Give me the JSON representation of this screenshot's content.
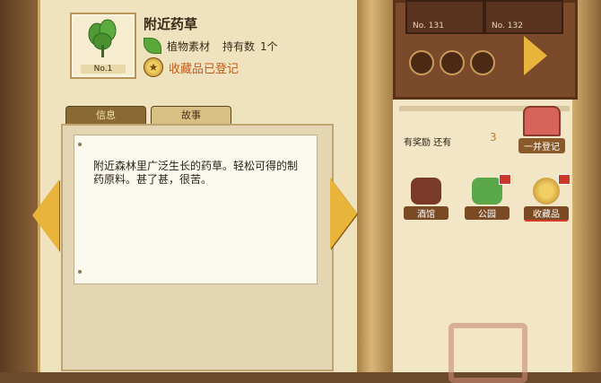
{
  "item": {
    "name": "附近药草",
    "number_label": "No.1",
    "category": "植物素材",
    "owned_label": "持有数",
    "owned_count": "1个",
    "collection_status": "收藏品已登记"
  },
  "tabs": [
    {
      "label": "信息"
    },
    {
      "label": "故事"
    }
  ],
  "description": "附近森林里广泛生长的药草。轻松可得的制药原料。甚了甚，很苦。",
  "shelf": {
    "slot_a": "No. 131",
    "slot_b": "No. 132"
  },
  "reward": {
    "label": "有奖励 还有",
    "count": "3"
  },
  "register_button": "一并登记",
  "nav": [
    {
      "label": "酒馆"
    },
    {
      "label": "公园"
    },
    {
      "label": "收藏品"
    }
  ],
  "colors": {
    "accent": "#e8b43a",
    "collection_orange": "#c85a18",
    "parchment": "#efe2bf"
  }
}
